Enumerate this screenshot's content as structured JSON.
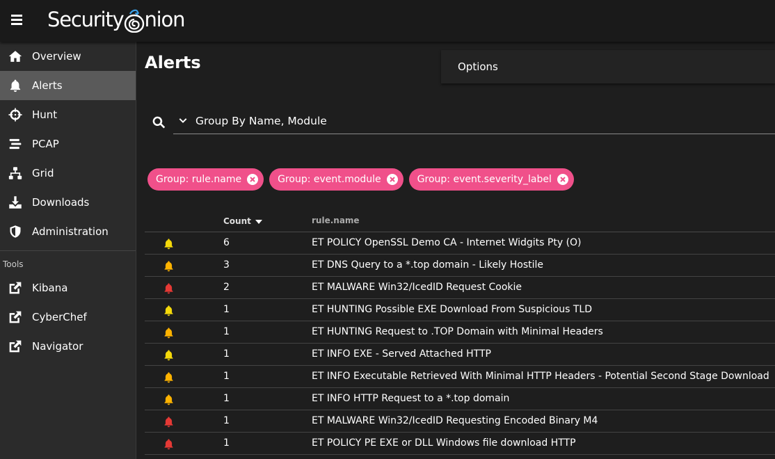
{
  "app": {
    "logo_text_pre": "Security",
    "logo_text_post": "nion"
  },
  "sidebar": {
    "items": [
      {
        "label": "Overview",
        "icon": "home-icon"
      },
      {
        "label": "Alerts",
        "icon": "bell-icon",
        "active": true
      },
      {
        "label": "Hunt",
        "icon": "crosshairs-icon"
      },
      {
        "label": "PCAP",
        "icon": "stream-icon"
      },
      {
        "label": "Grid",
        "icon": "network-icon"
      },
      {
        "label": "Downloads",
        "icon": "download-icon"
      },
      {
        "label": "Administration",
        "icon": "shield-icon"
      }
    ],
    "tools_label": "Tools",
    "tools": [
      {
        "label": "Kibana",
        "icon": "external-link-icon"
      },
      {
        "label": "CyberChef",
        "icon": "external-link-icon"
      },
      {
        "label": "Navigator",
        "icon": "external-link-icon"
      }
    ]
  },
  "main": {
    "title": "Alerts",
    "options_label": "Options",
    "query": "Group By Name, Module",
    "chips": [
      "Group: rule.name",
      "Group: event.module",
      "Group: event.severity_label"
    ],
    "table": {
      "headers": {
        "count": "Count",
        "rule": "rule.name"
      },
      "rows": [
        {
          "severity": "medium",
          "count": "6",
          "rule": "ET POLICY OpenSSL Demo CA - Internet Widgits Pty (O)"
        },
        {
          "severity": "low",
          "count": "3",
          "rule": "ET DNS Query to a *.top domain - Likely Hostile"
        },
        {
          "severity": "high",
          "count": "2",
          "rule": "ET MALWARE Win32/IcedID Request Cookie"
        },
        {
          "severity": "medium",
          "count": "1",
          "rule": "ET HUNTING Possible EXE Download From Suspicious TLD"
        },
        {
          "severity": "low",
          "count": "1",
          "rule": "ET HUNTING Request to .TOP Domain with Minimal Headers"
        },
        {
          "severity": "medium",
          "count": "1",
          "rule": "ET INFO EXE - Served Attached HTTP"
        },
        {
          "severity": "low",
          "count": "1",
          "rule": "ET INFO Executable Retrieved With Minimal HTTP Headers - Potential Second Stage Download"
        },
        {
          "severity": "low",
          "count": "1",
          "rule": "ET INFO HTTP Request to a *.top domain"
        },
        {
          "severity": "high",
          "count": "1",
          "rule": "ET MALWARE Win32/IcedID Requesting Encoded Binary M4"
        },
        {
          "severity": "high",
          "count": "1",
          "rule": "ET POLICY PE EXE or DLL Windows file download HTTP"
        }
      ]
    }
  },
  "colors": {
    "chip": "#f0508a",
    "bell_medium": "#f5d90a",
    "bell_low": "#ffb300",
    "bell_high": "#e53935"
  }
}
